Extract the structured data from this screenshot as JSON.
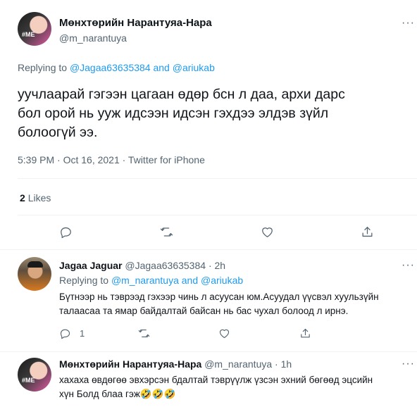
{
  "main_tweet": {
    "author_name": "Мөнхтөрийн Нарантуяа-Нара",
    "author_handle": "@m_narantuya",
    "replying_to_label": "Replying to",
    "replying_to_user1": "@Jagaa63635384",
    "replying_to_and": "and",
    "replying_to_user2": "@ariukab",
    "text_line1": "уучлаарай гэгээн цагаан өдөр бсн л даа, архи дарс",
    "text_line2": "бол орой нь ууж идсээн идсэн гэхдээ элдэв зүйл",
    "text_line3": "болоогүй ээ.",
    "timestamp": "5:39 PM · Oct 16, 2021 · Twitter for iPhone",
    "likes_count": "2",
    "likes_label": "Likes"
  },
  "reply1": {
    "author_name": "Jagaa Jaguar",
    "author_handle": "@Jagaa63635384",
    "time": "· 2h",
    "replying_to_label": "Replying to",
    "replying_to_user1": "@m_narantuya",
    "replying_to_and": "and",
    "replying_to_user2": "@ariukab",
    "text_line1": "Бүтнээр нь тэврээд гэхээр чинь л асуусан юм.Асуудал үүсвэл хуульзүйн",
    "text_line2": "талаасаа та ямар байдалтай байсан нь бас чухал болоод л ирнэ.",
    "reply_count": "1"
  },
  "reply2": {
    "author_name": "Мөнхтөрийн Нарантуяа-Нара",
    "author_handle": "@m_narantuya",
    "time": "· 1h",
    "text_line1": "хахаха өвдөгөө эвхэрсэн бдалтай тэврүүлж үзсэн эхний бөгөөд эцсийн",
    "text_line2": "хүн Болд блаа гэж🤣🤣🤣"
  },
  "colors": {
    "accent": "#1d9bf0",
    "text": "#0f1419",
    "muted": "#536471",
    "divider": "#eff3f4"
  },
  "avatar_text": "#ME"
}
